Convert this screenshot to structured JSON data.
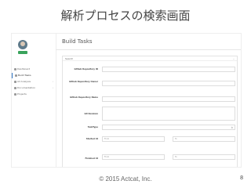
{
  "slide": {
    "title": "解析プロセスの検索画面",
    "footer": "© 2015 Actcat, Inc.",
    "page_number": "8"
  },
  "app": {
    "user_badge": "",
    "sidebar": {
      "items": [
        {
          "label": "Dashboard",
          "icon": "dashboard-icon",
          "has_submenu": false
        },
        {
          "label": "Build Tasks",
          "icon": "build-icon",
          "has_submenu": false,
          "active": true
        },
        {
          "label": "All Analysis",
          "icon": "analysis-icon",
          "has_submenu": true
        },
        {
          "label": "Documentation",
          "icon": "docs-icon",
          "has_submenu": true
        },
        {
          "label": "Projects",
          "icon": "projects-icon",
          "has_submenu": false
        }
      ]
    },
    "page_title": "Build Tasks",
    "search_panel": {
      "heading": "Search",
      "collapse_symbol": "−",
      "fields": [
        {
          "label": "Github Repository ID",
          "type": "text",
          "value": ""
        },
        {
          "label": "Github Repository Owner",
          "type": "text",
          "value": ""
        },
        {
          "label": "Github Repository Name",
          "type": "text",
          "value": ""
        },
        {
          "label": "Git Revision",
          "type": "textarea",
          "value": ""
        },
        {
          "label": "TaskType",
          "type": "select",
          "value": ""
        },
        {
          "label": "Started At",
          "type": "range",
          "from_placeholder": "From",
          "to_placeholder": "To"
        },
        {
          "label": "Finished At",
          "type": "range",
          "from_placeholder": "From",
          "to_placeholder": "To"
        }
      ]
    }
  },
  "colors": {
    "accent": "#2d73c2",
    "badge": "#3aa35c"
  }
}
